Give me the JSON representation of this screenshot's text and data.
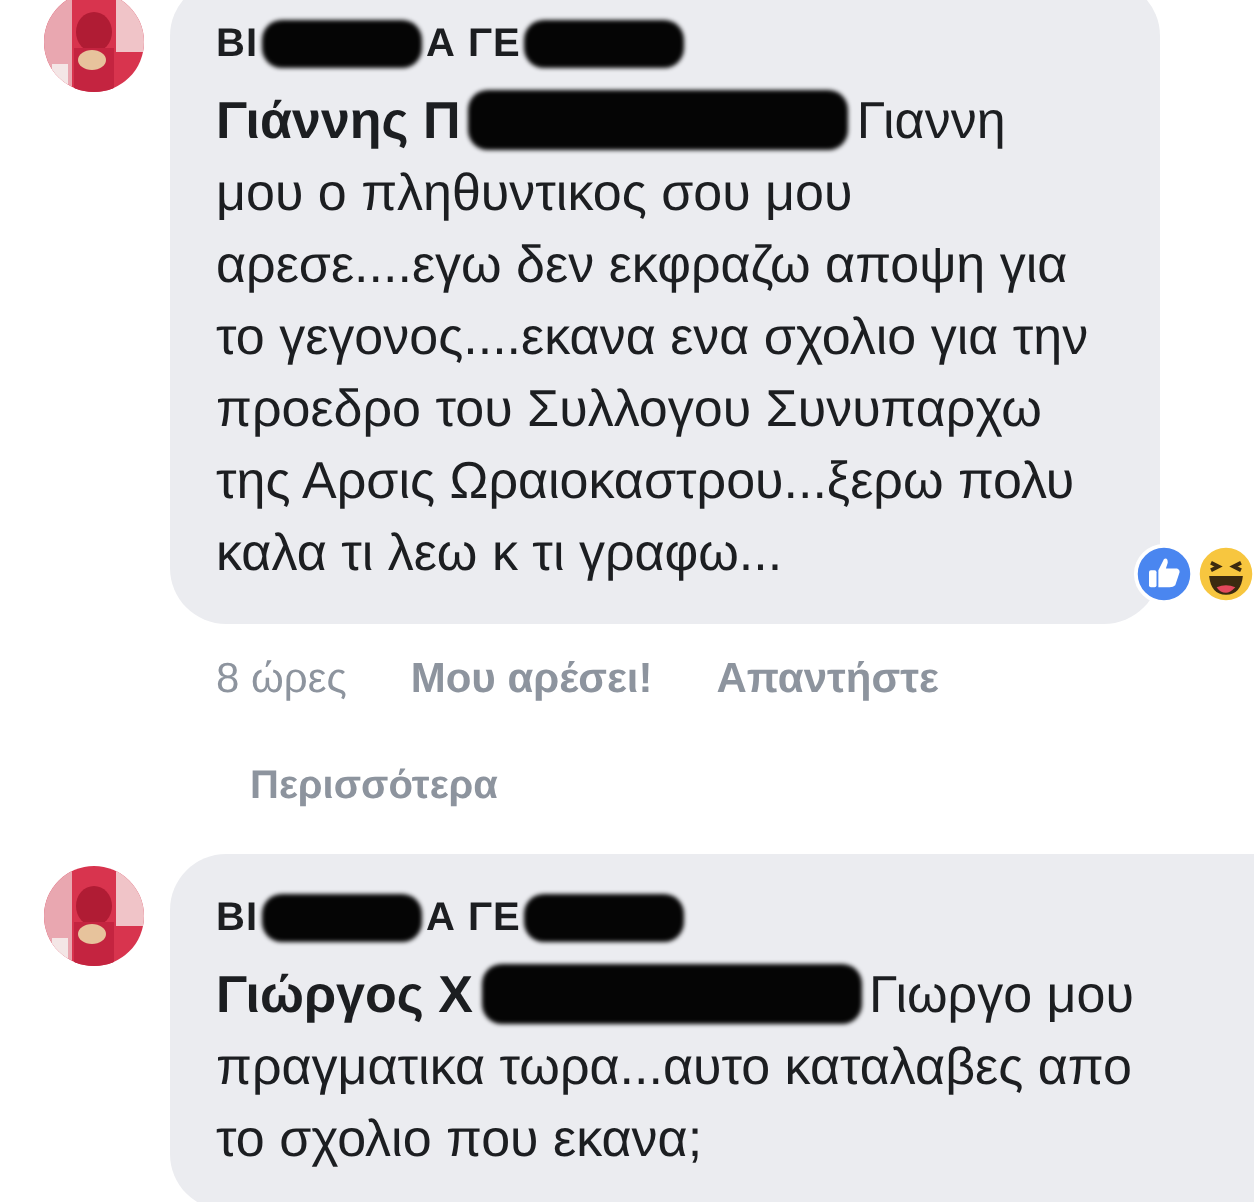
{
  "thread": [
    {
      "kind": "comment",
      "author": [
        {
          "kind": "text",
          "text": "ΒΙ"
        },
        {
          "kind": "redaction"
        },
        {
          "kind": "text",
          "text": "Α ΓΕ"
        },
        {
          "kind": "redaction"
        }
      ],
      "first_line": [
        {
          "kind": "mention",
          "text": "Γιάννης Π"
        },
        {
          "kind": "redaction"
        },
        {
          "kind": "text",
          "text": "Γιαννη"
        }
      ],
      "text": "μου ο πληθυντικος σου μου αρεσε....εγω δεν εκφραζω αποψη για το γεγονος....εκανα ενα σχολιο για την προεδρο του Συλλογου Συνυπαρχω της Αρσις Ωραιοκαστρου...ξερω πολυ καλα τι λεω κ τι γραφω...",
      "reactions": [
        {
          "kind": "like"
        },
        {
          "kind": "haha"
        }
      ],
      "time": "8 ώρες",
      "actions": [
        "Μου αρέσει!",
        "Απαντήστε"
      ]
    },
    {
      "kind": "more",
      "text": "Περισσότερα"
    },
    {
      "kind": "comment",
      "author": [
        {
          "kind": "text",
          "text": "ΒΙ"
        },
        {
          "kind": "redaction"
        },
        {
          "kind": "text",
          "text": "Α ΓΕ"
        },
        {
          "kind": "redaction"
        }
      ],
      "first_line": [
        {
          "kind": "mention",
          "text": "Γιώργος Χ"
        },
        {
          "kind": "redaction"
        },
        {
          "kind": "text",
          "text": "Γιωργο μου"
        }
      ],
      "text": "πραγματικα τωρα...αυτο καταλαβες απο το σχολιο που εκανα;"
    }
  ]
}
